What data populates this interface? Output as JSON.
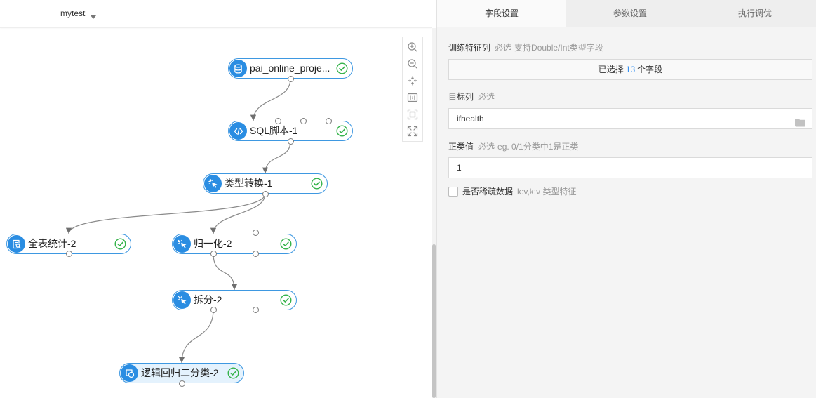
{
  "header": {
    "project_name": "mytest",
    "dropdown_icon": "caret-down-icon"
  },
  "canvas": {
    "nodes": [
      {
        "label": "pai_online_proje...",
        "icon": "database-icon",
        "status_icon": "check-circle-icon"
      },
      {
        "label": "SQL脚本-1",
        "icon": "code-icon",
        "status_icon": "check-circle-icon"
      },
      {
        "label": "类型转换-1",
        "icon": "pointer-click-icon",
        "status_icon": "check-circle-icon"
      },
      {
        "label": "全表统计-2",
        "icon": "search-document-icon",
        "status_icon": "check-circle-icon"
      },
      {
        "label": "归一化-2",
        "icon": "pointer-click-icon",
        "status_icon": "check-circle-icon"
      },
      {
        "label": "拆分-2",
        "icon": "pointer-click-icon",
        "status_icon": "check-circle-icon"
      },
      {
        "label": "逻辑回归二分类-2",
        "icon": "model-icon",
        "status_icon": "check-circle-icon",
        "selected": true
      }
    ],
    "toolbar": [
      {
        "icon": "zoom-in-icon"
      },
      {
        "icon": "zoom-out-icon"
      },
      {
        "icon": "fit-center-icon"
      },
      {
        "icon": "actual-size-icon"
      },
      {
        "icon": "fit-view-icon"
      },
      {
        "icon": "fullscreen-icon"
      }
    ]
  },
  "colors": {
    "accent": "#2a8de2",
    "node_border": "#3e98e1",
    "success": "#35b34a",
    "selected_fill": "#e4f2fd",
    "count_highlight": "#2d8cf0"
  },
  "panel": {
    "tabs": [
      {
        "label": "字段设置",
        "active": true
      },
      {
        "label": "参数设置",
        "active": false
      },
      {
        "label": "执行调优",
        "active": false
      }
    ],
    "feature_columns": {
      "label": "训练特征列",
      "required": "必选",
      "hint": "支持Double/Int类型字段",
      "button_prefix": "已选择",
      "count": "13",
      "button_suffix": "个字段"
    },
    "target_column": {
      "label": "目标列",
      "required": "必选",
      "value": "ifhealth",
      "icon": "folder-icon"
    },
    "positive_value": {
      "label": "正类值",
      "required": "必选",
      "hint": "eg. 0/1分类中1是正类",
      "value": "1"
    },
    "sparse": {
      "label": "是否稀疏数据",
      "hint": "k:v,k:v 类型特征",
      "checked": false
    }
  }
}
